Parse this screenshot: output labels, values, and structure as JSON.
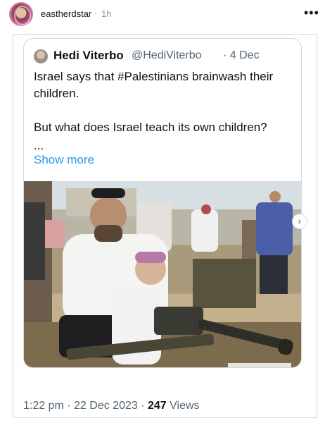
{
  "header": {
    "username": "eastherdstar",
    "separator": "·",
    "time": "1h",
    "more_icon": "more-horizontal-icon"
  },
  "quote": {
    "name": "Hedi Viterbo",
    "handle": "@HediViterbo",
    "date": "· 4 Dec",
    "text_line1": "Israel says that #Palestinians brainwash their children.",
    "text_line2": "But what does Israel teach its own children?",
    "ellipsis": "...",
    "show_more": "Show more",
    "next_icon": "chevron-right-icon"
  },
  "footer": {
    "time": "1:22 pm",
    "sep1": " · ",
    "date": "22 Dec 2023",
    "sep2": " · ",
    "views_count": "247",
    "views_label": " Views"
  },
  "colors": {
    "link": "#1d9bf0",
    "muted": "#536471",
    "border": "#cfd9de"
  }
}
